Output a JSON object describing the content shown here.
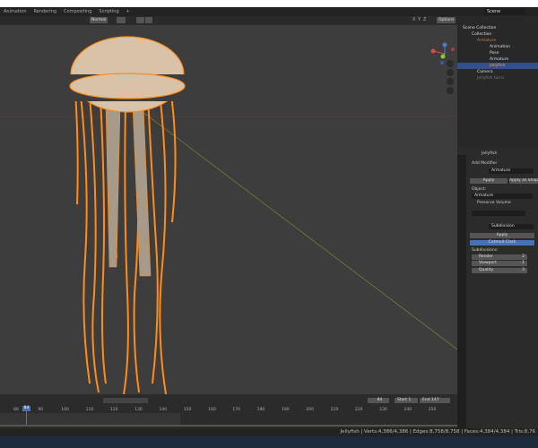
{
  "topbar": {
    "workspaces": [
      "Animation",
      "Rendering",
      "Compositing",
      "Scripting",
      "+"
    ],
    "scene": "Scene"
  },
  "viewport_header": {
    "orientation": "Normal",
    "options": "Options",
    "axes": [
      "X",
      "Y",
      "Z"
    ]
  },
  "outliner": {
    "items": [
      {
        "label": "Scene Collection",
        "icon": "collection-icon"
      },
      {
        "label": "Collection",
        "icon": "collection-icon"
      },
      {
        "label": "Armature",
        "icon": "armature-icon"
      },
      {
        "label": "Animation",
        "icon": "action-icon"
      },
      {
        "label": "Pose",
        "icon": "pose-icon"
      },
      {
        "label": "Armature",
        "icon": "armature-data-icon"
      },
      {
        "label": "Jellyfish",
        "icon": "mesh-icon",
        "selected": true
      },
      {
        "label": "Camera",
        "icon": "camera-icon"
      },
      {
        "label": "Jellyfish turns",
        "icon": "collection-icon"
      }
    ]
  },
  "properties": {
    "object": "Jellyfish",
    "add_modifier": "Add Modifier",
    "mod1": {
      "name": "Armature",
      "apply": "Apply",
      "apply_shape": "Apply as Shape",
      "object_label": "Object:",
      "object_value": "Armature",
      "preserve_volume": "Preserve Volume"
    },
    "mod2": {
      "name": "Subdivision",
      "apply": "Apply",
      "mode": "Catmull-Clark",
      "subdivisions": "Subdivisions:",
      "render_label": "Render",
      "render_value": "2",
      "viewport_label": "Viewport",
      "viewport_value": "1",
      "quality_label": "Quality",
      "quality_value": "3"
    }
  },
  "timeline": {
    "current_frame": "84",
    "start_label": "Start",
    "start": "1",
    "end_label": "End",
    "end": "147",
    "ticks": [
      "80",
      "90",
      "100",
      "110",
      "120",
      "130",
      "140",
      "150",
      "160",
      "170",
      "180",
      "190",
      "200",
      "210",
      "220",
      "230",
      "240",
      "250"
    ]
  },
  "status": "Jellyfish | Verts:4,386/4,386 | Edges:8,758/8,758 | Faces:4,384/4,384 | Tris:8,76",
  "colors": {
    "accent": "#4772b3",
    "wire": "#ff8c1a",
    "mesh": "#d9c3a8"
  }
}
